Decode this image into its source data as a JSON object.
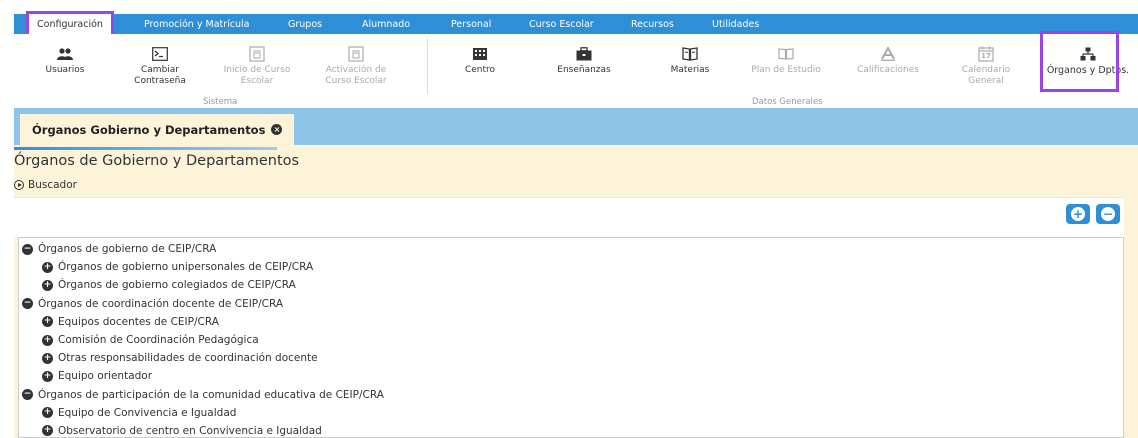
{
  "menu": [
    {
      "label": "Configuración",
      "active": true
    },
    {
      "label": "Promoción y Matrícula"
    },
    {
      "label": "Grupos"
    },
    {
      "label": "Alumnado"
    },
    {
      "label": "Personal"
    },
    {
      "label": "Curso Escolar"
    },
    {
      "label": "Recursos"
    },
    {
      "label": "Utilidades"
    }
  ],
  "toolbar": {
    "usuarios": {
      "label": "Usuarios",
      "icon": "users-icon"
    },
    "cambiar": {
      "label": "Cambiar Contraseña",
      "icon": "terminal-icon"
    },
    "inicio": {
      "label": "Inicio de Curso Escolar",
      "icon": "document-icon"
    },
    "activacion": {
      "label": "Activación de Curso Escolar",
      "icon": "document-icon"
    },
    "centro": {
      "label": "Centro",
      "icon": "building-icon"
    },
    "ensenanzas": {
      "label": "Enseñanzas",
      "icon": "briefcase-icon"
    },
    "materias": {
      "label": "Materias",
      "icon": "book-icon"
    },
    "plan": {
      "label": "Plan de Estudio",
      "icon": "open-book-icon"
    },
    "calificaciones": {
      "label": "Calificaciones",
      "icon": "grade-a-icon"
    },
    "calendario": {
      "label": "Calendario General",
      "icon": "calendar-icon",
      "day": "17"
    },
    "organos": {
      "label": "Órganos y Dptos.",
      "icon": "org-chart-icon"
    },
    "group_sistema": "Sistema",
    "group_datos": "Datos Generales"
  },
  "tab": {
    "label": "Órganos Gobierno y Departamentos",
    "close": "×"
  },
  "page": {
    "title": "Órganos de Gobierno y Departamentos",
    "buscador": "Buscador",
    "expand_all": "+",
    "collapse_all": "−"
  },
  "tree": [
    {
      "level": 0,
      "expanded": true,
      "label": "Órganos de gobierno de CEIP/CRA"
    },
    {
      "level": 1,
      "expanded": false,
      "label": "Órganos de gobierno unipersonales de CEIP/CRA"
    },
    {
      "level": 1,
      "expanded": false,
      "label": "Órganos de gobierno colegiados de CEIP/CRA"
    },
    {
      "level": 0,
      "expanded": true,
      "label": "Órganos de coordinación docente de CEIP/CRA"
    },
    {
      "level": 1,
      "expanded": false,
      "label": "Equipos docentes de CEIP/CRA"
    },
    {
      "level": 1,
      "expanded": false,
      "label": "Comisión de Coordinación Pedagógica"
    },
    {
      "level": 1,
      "expanded": false,
      "label": "Otras responsabilidades de coordinación docente"
    },
    {
      "level": 1,
      "expanded": false,
      "label": "Equipo orientador"
    },
    {
      "level": 0,
      "expanded": true,
      "label": "Órganos de participación de la comunidad educativa de CEIP/CRA"
    },
    {
      "level": 1,
      "expanded": false,
      "label": "Equipo de Convivencia e Igualdad"
    },
    {
      "level": 1,
      "expanded": false,
      "label": "Observatorio de centro en Convivencia e Igualdad"
    }
  ],
  "colors": {
    "accent": "#2f8fd6",
    "highlight": "#9b44e8",
    "content_bg": "#fdf3d8"
  }
}
